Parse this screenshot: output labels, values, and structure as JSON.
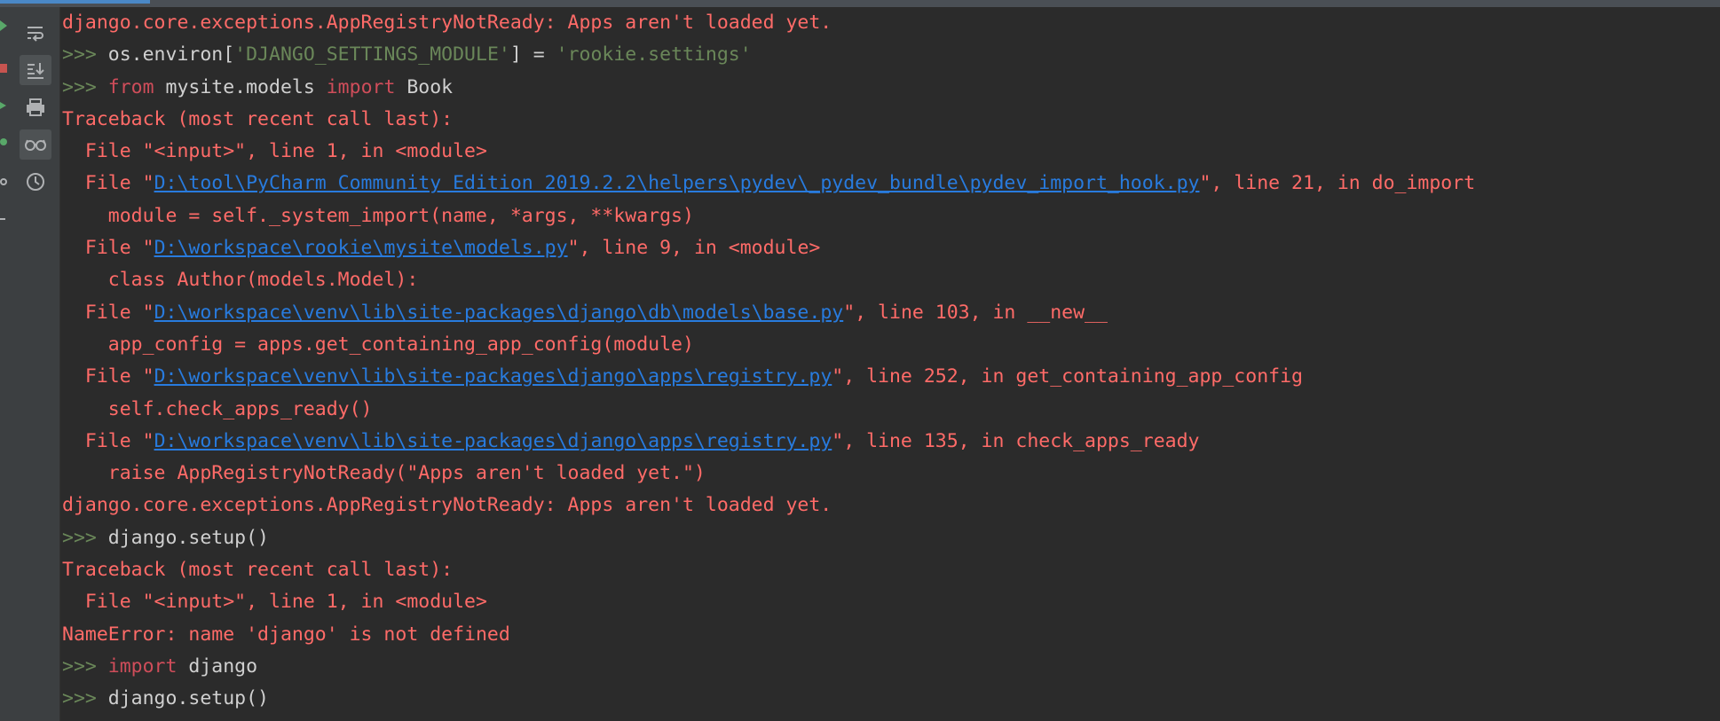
{
  "progress": 0.087,
  "toolbar": {
    "buttons": [
      {
        "name": "soft-wrap-icon"
      },
      {
        "name": "scroll-to-end-icon"
      },
      {
        "name": "print-icon"
      },
      {
        "name": "show-variables-icon"
      },
      {
        "name": "history-icon"
      }
    ]
  },
  "console": {
    "lines": [
      {
        "segments": [
          {
            "cls": "err",
            "text": "django.core.exceptions.AppRegistryNotReady: Apps aren't loaded yet."
          }
        ]
      },
      {
        "segments": [
          {
            "cls": "prompt",
            "text": ">>> "
          },
          {
            "cls": "id",
            "text": "os.environ["
          },
          {
            "cls": "str",
            "text": "'DJANGO_SETTINGS_MODULE'"
          },
          {
            "cls": "id",
            "text": "] = "
          },
          {
            "cls": "str",
            "text": "'rookie.settings'"
          }
        ]
      },
      {
        "segments": [
          {
            "cls": "prompt",
            "text": ">>> "
          },
          {
            "cls": "kwr",
            "text": "from"
          },
          {
            "cls": "id",
            "text": " mysite.models "
          },
          {
            "cls": "kwr",
            "text": "import"
          },
          {
            "cls": "id",
            "text": " Book"
          }
        ]
      },
      {
        "segments": [
          {
            "cls": "err",
            "text": "Traceback (most recent call last):"
          }
        ]
      },
      {
        "segments": [
          {
            "cls": "err",
            "text": "  File \"<input>\", line 1, in <module>"
          }
        ]
      },
      {
        "segments": [
          {
            "cls": "err",
            "text": "  File \""
          },
          {
            "cls": "link",
            "text": "D:\\tool\\PyCharm Community Edition 2019.2.2\\helpers\\pydev\\_pydev_bundle\\pydev_import_hook.py"
          },
          {
            "cls": "err",
            "text": "\", line 21, in do_import"
          }
        ]
      },
      {
        "segments": [
          {
            "cls": "err",
            "text": "    module = self._system_import(name, *args, **kwargs)"
          }
        ]
      },
      {
        "segments": [
          {
            "cls": "err",
            "text": "  File \""
          },
          {
            "cls": "link",
            "text": "D:\\workspace\\rookie\\mysite\\models.py"
          },
          {
            "cls": "err",
            "text": "\", line 9, in <module>"
          }
        ]
      },
      {
        "segments": [
          {
            "cls": "err",
            "text": "    class Author(models.Model):"
          }
        ]
      },
      {
        "segments": [
          {
            "cls": "err",
            "text": "  File \""
          },
          {
            "cls": "link",
            "text": "D:\\workspace\\venv\\lib\\site-packages\\django\\db\\models\\base.py"
          },
          {
            "cls": "err",
            "text": "\", line 103, in __new__"
          }
        ]
      },
      {
        "segments": [
          {
            "cls": "err",
            "text": "    app_config = apps.get_containing_app_config(module)"
          }
        ]
      },
      {
        "segments": [
          {
            "cls": "err",
            "text": "  File \""
          },
          {
            "cls": "link",
            "text": "D:\\workspace\\venv\\lib\\site-packages\\django\\apps\\registry.py"
          },
          {
            "cls": "err",
            "text": "\", line 252, in get_containing_app_config"
          }
        ]
      },
      {
        "segments": [
          {
            "cls": "err",
            "text": "    self.check_apps_ready()"
          }
        ]
      },
      {
        "segments": [
          {
            "cls": "err",
            "text": "  File \""
          },
          {
            "cls": "link",
            "text": "D:\\workspace\\venv\\lib\\site-packages\\django\\apps\\registry.py"
          },
          {
            "cls": "err",
            "text": "\", line 135, in check_apps_ready"
          }
        ]
      },
      {
        "segments": [
          {
            "cls": "err",
            "text": "    raise AppRegistryNotReady(\"Apps aren't loaded yet.\")"
          }
        ]
      },
      {
        "segments": [
          {
            "cls": "err",
            "text": "django.core.exceptions.AppRegistryNotReady: Apps aren't loaded yet."
          }
        ]
      },
      {
        "segments": [
          {
            "cls": "prompt",
            "text": ">>> "
          },
          {
            "cls": "id",
            "text": "django.setup()"
          }
        ]
      },
      {
        "segments": [
          {
            "cls": "err",
            "text": "Traceback (most recent call last):"
          }
        ]
      },
      {
        "segments": [
          {
            "cls": "err",
            "text": "  File \"<input>\", line 1, in <module>"
          }
        ]
      },
      {
        "segments": [
          {
            "cls": "err",
            "text": "NameError: name 'django' is not defined"
          }
        ]
      },
      {
        "segments": [
          {
            "cls": "prompt",
            "text": ">>> "
          },
          {
            "cls": "kwr",
            "text": "import"
          },
          {
            "cls": "id",
            "text": " django"
          }
        ]
      },
      {
        "segments": [
          {
            "cls": "prompt",
            "text": ">>> "
          },
          {
            "cls": "id",
            "text": "django.setup()"
          }
        ]
      }
    ]
  }
}
